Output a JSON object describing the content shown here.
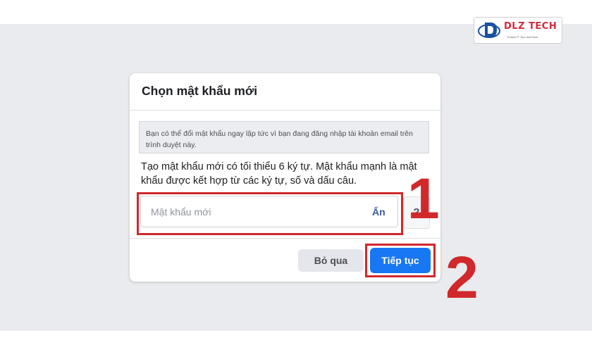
{
  "watermark": {
    "brand": "DLZ TECH",
    "tagline": "Trusted IT Tips and More"
  },
  "dialog": {
    "title": "Chọn mật khẩu mới",
    "notice": "Bạn có thể đổi mật khẩu ngay lập tức vì bạn đang đăng nhập tài khoản email trên trình duyệt này.",
    "instructions": "Tạo mật khẩu mới có tối thiểu 6 ký tự. Mật khẩu mạnh là mật khẩu được kết hợp từ các ký tự, số và dấu câu.",
    "password_field": {
      "placeholder": "Mật khẩu mới",
      "value": "",
      "toggle_label": "Ẩn"
    },
    "help_label": "?",
    "skip_label": "Bỏ qua",
    "continue_label": "Tiếp tục"
  },
  "annotations": {
    "step1": "1",
    "step2": "2",
    "color": "#d0282b"
  },
  "colors": {
    "background": "#e9ebee",
    "primary": "#1877f2",
    "link": "#3b5998"
  }
}
